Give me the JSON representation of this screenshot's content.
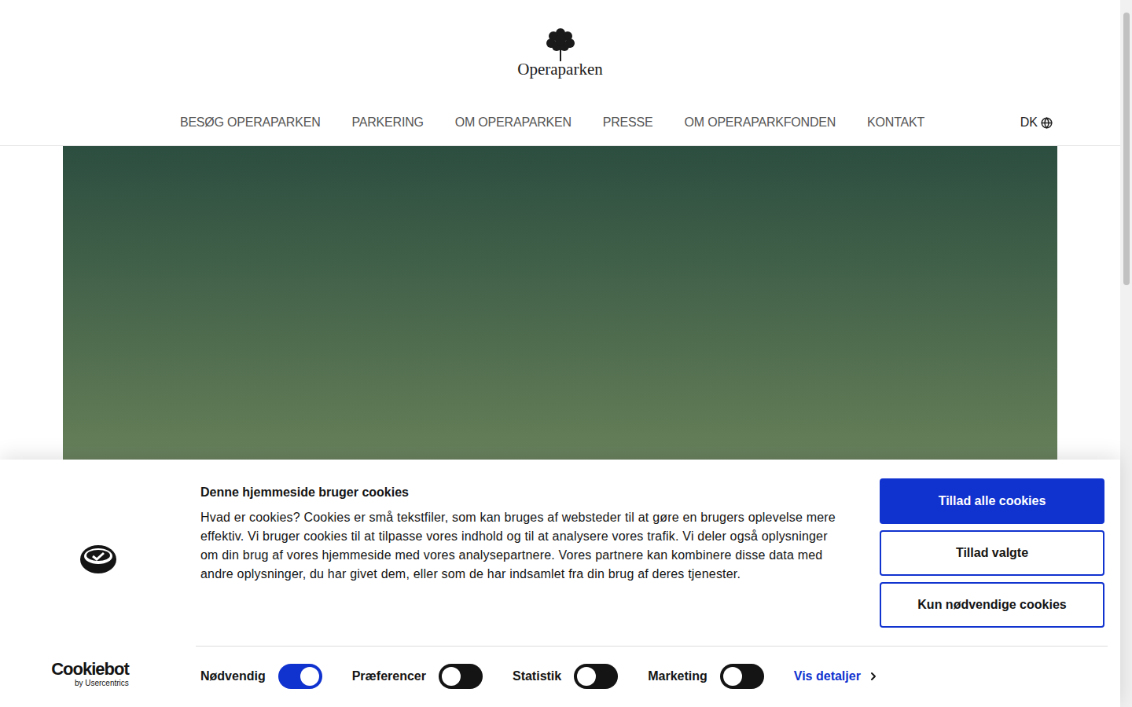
{
  "site": {
    "logo_text": "Operaparken"
  },
  "nav": {
    "items": [
      "BESØG OPERAPARKEN",
      "PARKERING",
      "OM OPERAPARKEN",
      "PRESSE",
      "OM OPERAPARKFONDEN",
      "KONTAKT"
    ],
    "language": "DK"
  },
  "cookie_banner": {
    "title": "Denne hjemmeside bruger cookies",
    "body": "Hvad er cookies? Cookies er små tekstfiler, som kan bruges af websteder til at gøre en brugers oplevelse mere effektiv. Vi bruger cookies til at tilpasse vores indhold og til at analysere vores trafik. Vi deler også oplysninger om din brug af vores hjemmeside med vores analysepartnere. Vores partnere kan kombinere disse data med andre oplysninger, du har givet dem, eller som de har indsamlet fra din brug af deres tjenester.",
    "buttons": [
      {
        "label": "Tillad alle cookies",
        "kind": "primary"
      },
      {
        "label": "Tillad valgte",
        "kind": "outline"
      },
      {
        "label": "Kun nødvendige cookies",
        "kind": "outline"
      }
    ],
    "toggles": [
      {
        "label": "Nødvendig",
        "on": true
      },
      {
        "label": "Præferencer",
        "on": false
      },
      {
        "label": "Statistik",
        "on": false
      },
      {
        "label": "Marketing",
        "on": false
      }
    ],
    "details_link": "Vis detaljer",
    "brand": {
      "name": "Cookiebot",
      "sub": "by Usercentrics"
    }
  }
}
